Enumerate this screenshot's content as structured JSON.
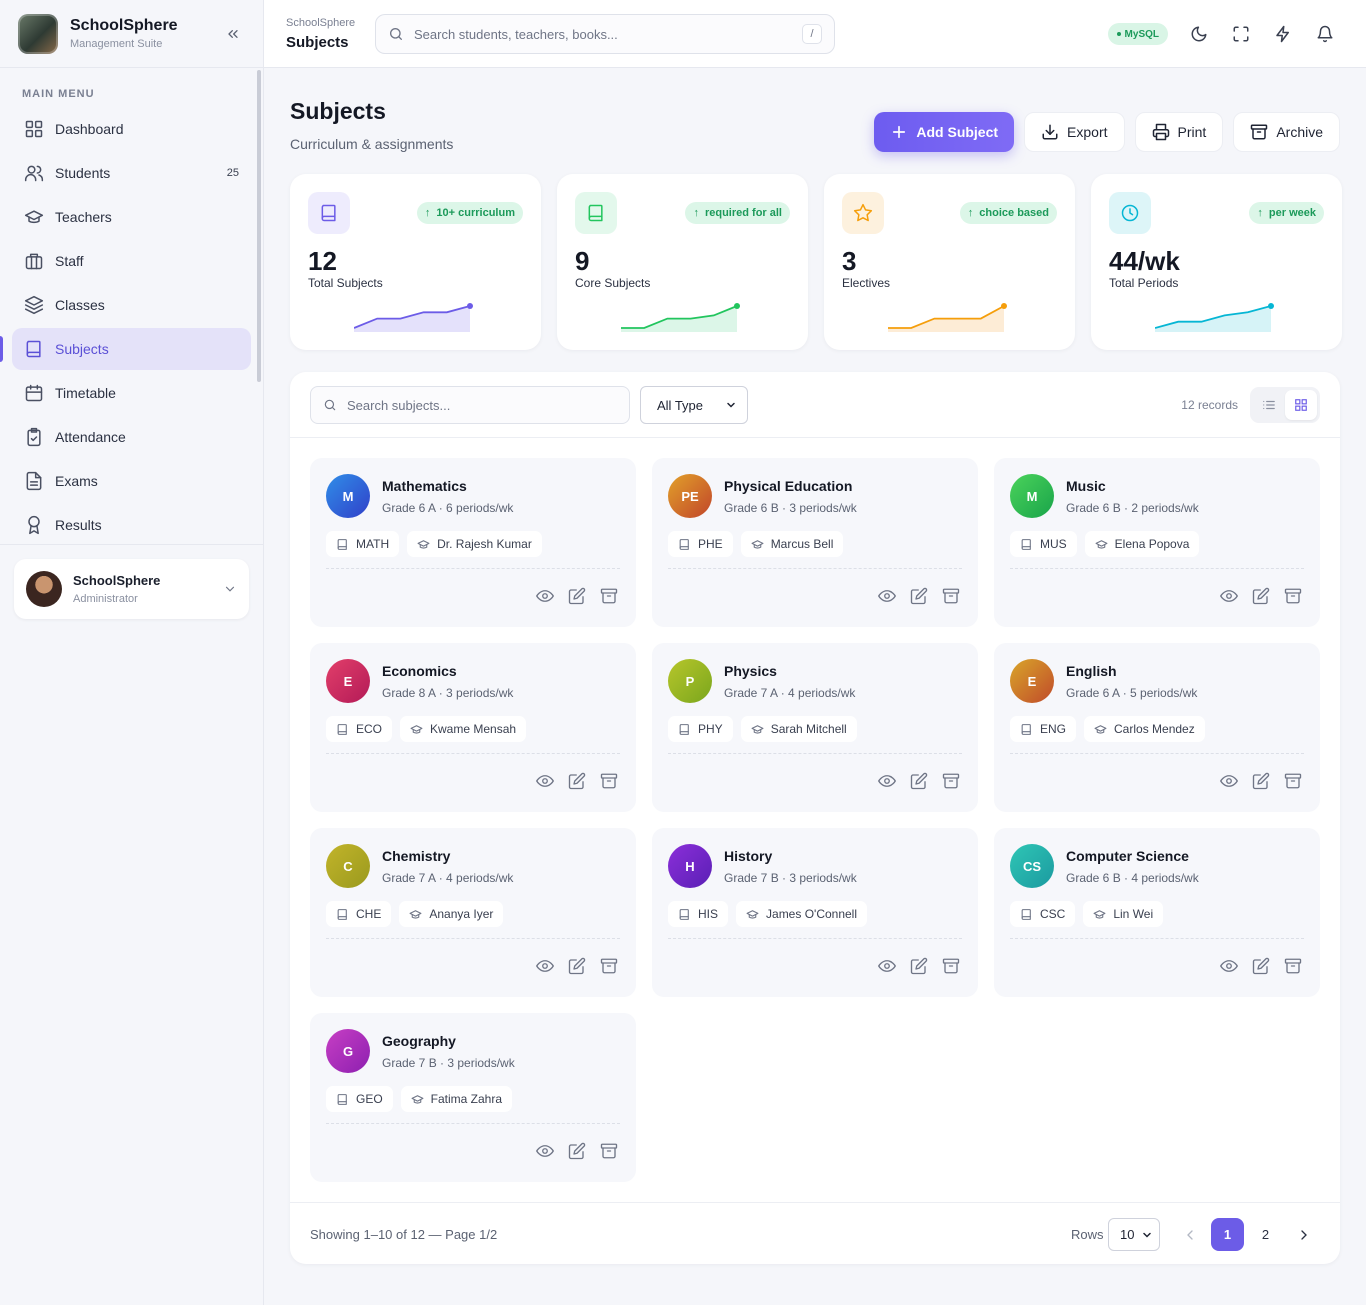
{
  "app": {
    "name": "SchoolSphere",
    "subtitle": "Management Suite"
  },
  "sidebar": {
    "heading": "MAIN MENU",
    "items": [
      {
        "label": "Dashboard",
        "icon": "grid-icon",
        "count": ""
      },
      {
        "label": "Students",
        "icon": "users-icon",
        "count": "25"
      },
      {
        "label": "Teachers",
        "icon": "graduation-cap-icon",
        "count": ""
      },
      {
        "label": "Staff",
        "icon": "briefcase-icon",
        "count": ""
      },
      {
        "label": "Classes",
        "icon": "layers-icon",
        "count": ""
      },
      {
        "label": "Subjects",
        "icon": "book-icon",
        "count": "",
        "active": true
      },
      {
        "label": "Timetable",
        "icon": "calendar-icon",
        "count": ""
      },
      {
        "label": "Attendance",
        "icon": "clipboard-check-icon",
        "count": ""
      },
      {
        "label": "Exams",
        "icon": "file-text-icon",
        "count": ""
      },
      {
        "label": "Results",
        "icon": "award-icon",
        "count": ""
      }
    ],
    "user": {
      "name": "SchoolSphere",
      "role": "Administrator"
    }
  },
  "topbar": {
    "crumb_small": "SchoolSphere",
    "crumb_big": "Subjects",
    "search_placeholder": "Search students, teachers, books...",
    "search_kbd": "/",
    "db_badge": "MySQL"
  },
  "page": {
    "title": "Subjects",
    "subtitle": "Curriculum & assignments",
    "actions": {
      "add": "Add Subject",
      "export": "Export",
      "print": "Print",
      "archive": "Archive"
    }
  },
  "stats": [
    {
      "value": "12",
      "label": "Total Subjects",
      "trend": "10+ curriculum",
      "icon": "book-icon",
      "color": "#6c5ce7",
      "bg": "#eeecfd",
      "fill": "#e4e1fb",
      "spark": [
        2,
        5,
        5,
        7,
        7,
        9
      ]
    },
    {
      "value": "9",
      "label": "Core Subjects",
      "trend": "required for all",
      "icon": "book-icon",
      "color": "#22c55e",
      "bg": "#e3f8ec",
      "fill": "#dcf6e8",
      "spark": [
        2,
        2,
        5,
        5,
        6,
        9
      ]
    },
    {
      "value": "3",
      "label": "Electives",
      "trend": "choice based",
      "icon": "star-icon",
      "color": "#f59e0b",
      "bg": "#fdf1de",
      "fill": "#fdecd6",
      "spark": [
        2,
        2,
        5,
        5,
        5,
        9
      ]
    },
    {
      "value": "44/wk",
      "label": "Total Periods",
      "trend": "per week",
      "icon": "clock-icon",
      "color": "#06b6d4",
      "bg": "#ddf5f8",
      "fill": "#d6f3f7",
      "spark": [
        2,
        4,
        4,
        6,
        7,
        9
      ]
    }
  ],
  "filters": {
    "search_placeholder": "Search subjects...",
    "type_value": "All Type",
    "records": "12 records"
  },
  "subjects": [
    {
      "initials": "M",
      "name": "Mathematics",
      "meta": "Grade 6 A · 6 periods/wk",
      "code": "MATH",
      "teacher": "Dr. Rajesh Kumar",
      "color1": "#2f8ee8",
      "color2": "#3140c9"
    },
    {
      "initials": "PE",
      "name": "Physical Education",
      "meta": "Grade 6 B · 3 periods/wk",
      "code": "PHE",
      "teacher": "Marcus Bell",
      "color1": "#e2a12a",
      "color2": "#c1452a"
    },
    {
      "initials": "M",
      "name": "Music",
      "meta": "Grade 6 B · 2 periods/wk",
      "code": "MUS",
      "teacher": "Elena Popova",
      "color1": "#4bd35b",
      "color2": "#19a44a"
    },
    {
      "initials": "E",
      "name": "Economics",
      "meta": "Grade 8 A · 3 periods/wk",
      "code": "ECO",
      "teacher": "Kwame Mensah",
      "color1": "#e23f6a",
      "color2": "#b31a57"
    },
    {
      "initials": "P",
      "name": "Physics",
      "meta": "Grade 7 A · 4 periods/wk",
      "code": "PHY",
      "teacher": "Sarah Mitchell",
      "color1": "#b7c62b",
      "color2": "#7aa61d"
    },
    {
      "initials": "E",
      "name": "English",
      "meta": "Grade 6 A · 5 periods/wk",
      "code": "ENG",
      "teacher": "Carlos Mendez",
      "color1": "#d9a62a",
      "color2": "#c04a2a"
    },
    {
      "initials": "C",
      "name": "Chemistry",
      "meta": "Grade 7 A · 4 periods/wk",
      "code": "CHE",
      "teacher": "Ananya Iyer",
      "color1": "#c2b42a",
      "color2": "#9a9a1e"
    },
    {
      "initials": "H",
      "name": "History",
      "meta": "Grade 7 B · 3 periods/wk",
      "code": "HIS",
      "teacher": "James O'Connell",
      "color1": "#8b2fd9",
      "color2": "#5a1fb5"
    },
    {
      "initials": "CS",
      "name": "Computer Science",
      "meta": "Grade 6 B · 4 periods/wk",
      "code": "CSC",
      "teacher": "Lin Wei",
      "color1": "#2fc6b5",
      "color2": "#1b9aa0"
    },
    {
      "initials": "G",
      "name": "Geography",
      "meta": "Grade 7 B · 3 periods/wk",
      "code": "GEO",
      "teacher": "Fatima Zahra",
      "color1": "#c73fc4",
      "color2": "#8d1fb0"
    }
  ],
  "footer": {
    "showing": "Showing 1–10 of 12 — Page 1/2",
    "rows_label": "Rows",
    "rows_value": "10",
    "pages": [
      "1",
      "2"
    ],
    "current_page": "1"
  },
  "colors": {
    "accent": "#6c5ce7",
    "success": "#1c9a5a"
  }
}
